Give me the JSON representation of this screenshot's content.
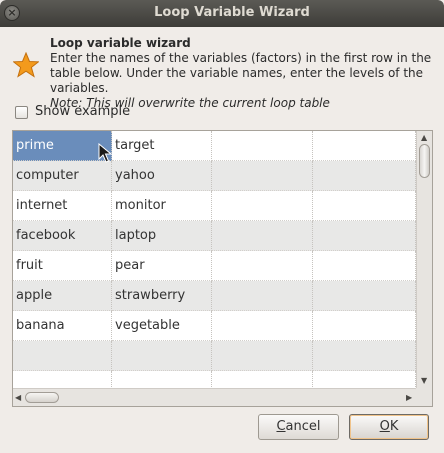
{
  "window": {
    "title": "Loop Variable Wizard"
  },
  "header": {
    "heading": "Loop variable wizard",
    "description": "Enter the names of the variables (factors) in the first row in the table below. Under the variable names, enter the levels of the variables.",
    "note": "Note: This will overwrite the current loop table"
  },
  "options": {
    "show_example_label": "Show example",
    "show_example_checked": false
  },
  "table": {
    "rows": [
      [
        "prime",
        "target",
        "",
        ""
      ],
      [
        "computer",
        "yahoo",
        "",
        ""
      ],
      [
        "internet",
        "monitor",
        "",
        ""
      ],
      [
        "facebook",
        "laptop",
        "",
        ""
      ],
      [
        "fruit",
        "pear",
        "",
        ""
      ],
      [
        "apple",
        "strawberry",
        "",
        ""
      ],
      [
        "banana",
        "vegetable",
        "",
        ""
      ],
      [
        "",
        "",
        "",
        ""
      ],
      [
        "",
        "",
        "",
        ""
      ]
    ],
    "selected_cell": [
      0,
      0
    ]
  },
  "buttons": {
    "cancel_mnemonic": "C",
    "cancel_rest": "ancel",
    "ok_mnemonic": "O",
    "ok_rest": "K"
  },
  "colors": {
    "selection": "#6a8dbb",
    "accent_icon": "#f39a1c"
  }
}
